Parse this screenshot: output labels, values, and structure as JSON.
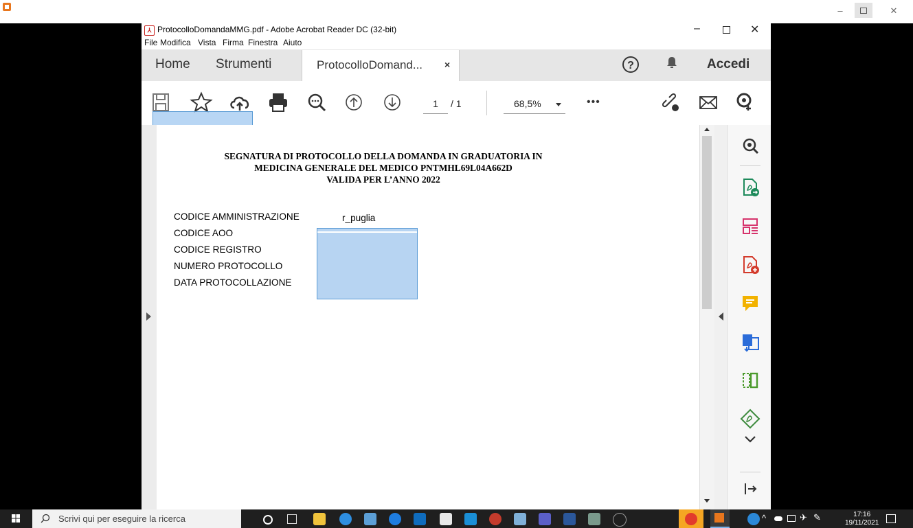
{
  "window": {
    "title": "ProtocolloDomandaMMG.pdf - Adobe Acrobat Reader DC (32-bit)",
    "pdf_badge": "⅄"
  },
  "menu": [
    "File",
    "Modifica",
    "Vista",
    "Firma",
    "Finestra",
    "Aiuto"
  ],
  "tabs": {
    "home": "Home",
    "tools": "Strumenti",
    "document": "ProtocolloDomand...",
    "close": "×",
    "help": "?",
    "sign_in": "Accedi"
  },
  "toolbar": {
    "page_current": "1",
    "page_total": "/ 1",
    "zoom": "68,5%",
    "more": "•••"
  },
  "document": {
    "title_lines": [
      "SEGNATURA DI PROTOCOLLO DELLA DOMANDA IN GRADUATORIA IN",
      "MEDICINA GENERALE DEL MEDICO PNTMHL69L04A662D",
      "VALIDA PER L’ANNO 2022"
    ],
    "fields": [
      {
        "label": "CODICE AMMINISTRAZIONE",
        "value": "r_puglia"
      },
      {
        "label": "CODICE AOO"
      },
      {
        "label": "CODICE REGISTRO"
      },
      {
        "label": "NUMERO PROTOCOLLO"
      },
      {
        "label": "DATA PROTOCOLLAZIONE"
      }
    ]
  },
  "taskbar": {
    "search_placeholder": "Scrivi qui per eseguire la ricerca",
    "time": "17:16",
    "date": "19/11/2021"
  },
  "colors": {
    "accent": "#c8211d",
    "selection": "#aacdf0",
    "taskbar": "#1f1f1f"
  }
}
